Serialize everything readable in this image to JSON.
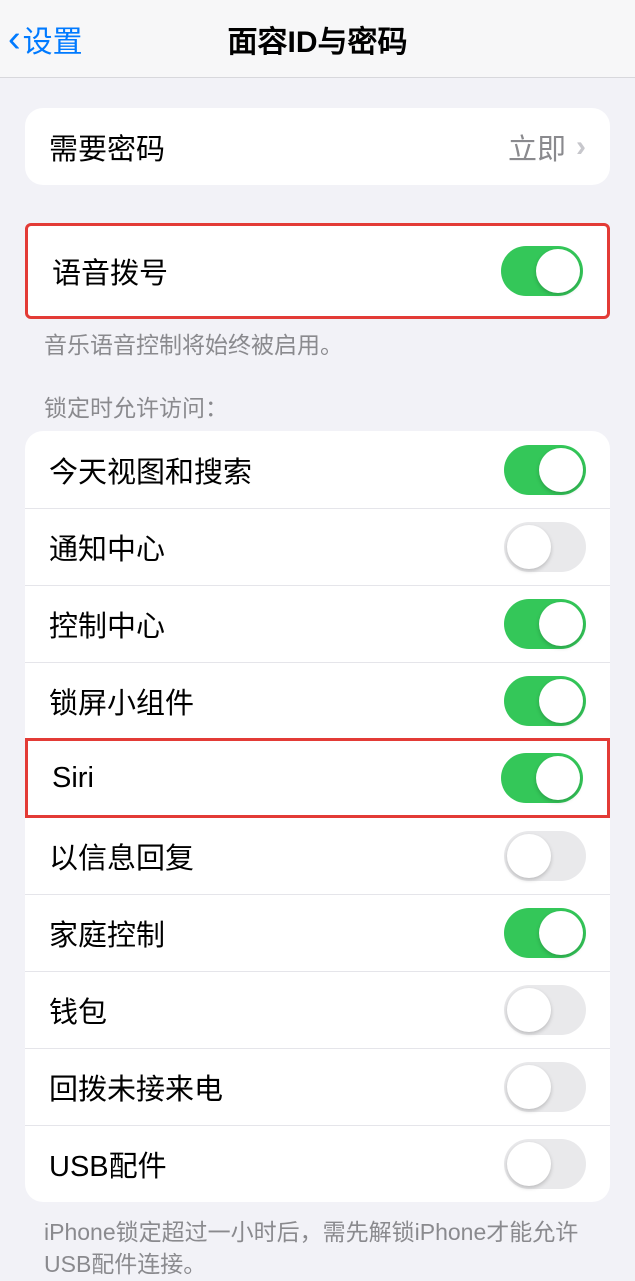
{
  "nav": {
    "back": "设置",
    "title": "面容ID与密码"
  },
  "passcode": {
    "label": "需要密码",
    "value": "立即"
  },
  "voice_dial": {
    "label": "语音拨号",
    "on": true,
    "footer": "音乐语音控制将始终被启用。"
  },
  "locked_access": {
    "header": "锁定时允许访问：",
    "items": [
      {
        "label": "今天视图和搜索",
        "on": true
      },
      {
        "label": "通知中心",
        "on": false
      },
      {
        "label": "控制中心",
        "on": true
      },
      {
        "label": "锁屏小组件",
        "on": true
      },
      {
        "label": "Siri",
        "on": true
      },
      {
        "label": "以信息回复",
        "on": false
      },
      {
        "label": "家庭控制",
        "on": true
      },
      {
        "label": "钱包",
        "on": false
      },
      {
        "label": "回拨未接来电",
        "on": false
      },
      {
        "label": "USB配件",
        "on": false
      }
    ],
    "footer": "iPhone锁定超过一小时后，需先解锁iPhone才能允许USB配件连接。"
  }
}
